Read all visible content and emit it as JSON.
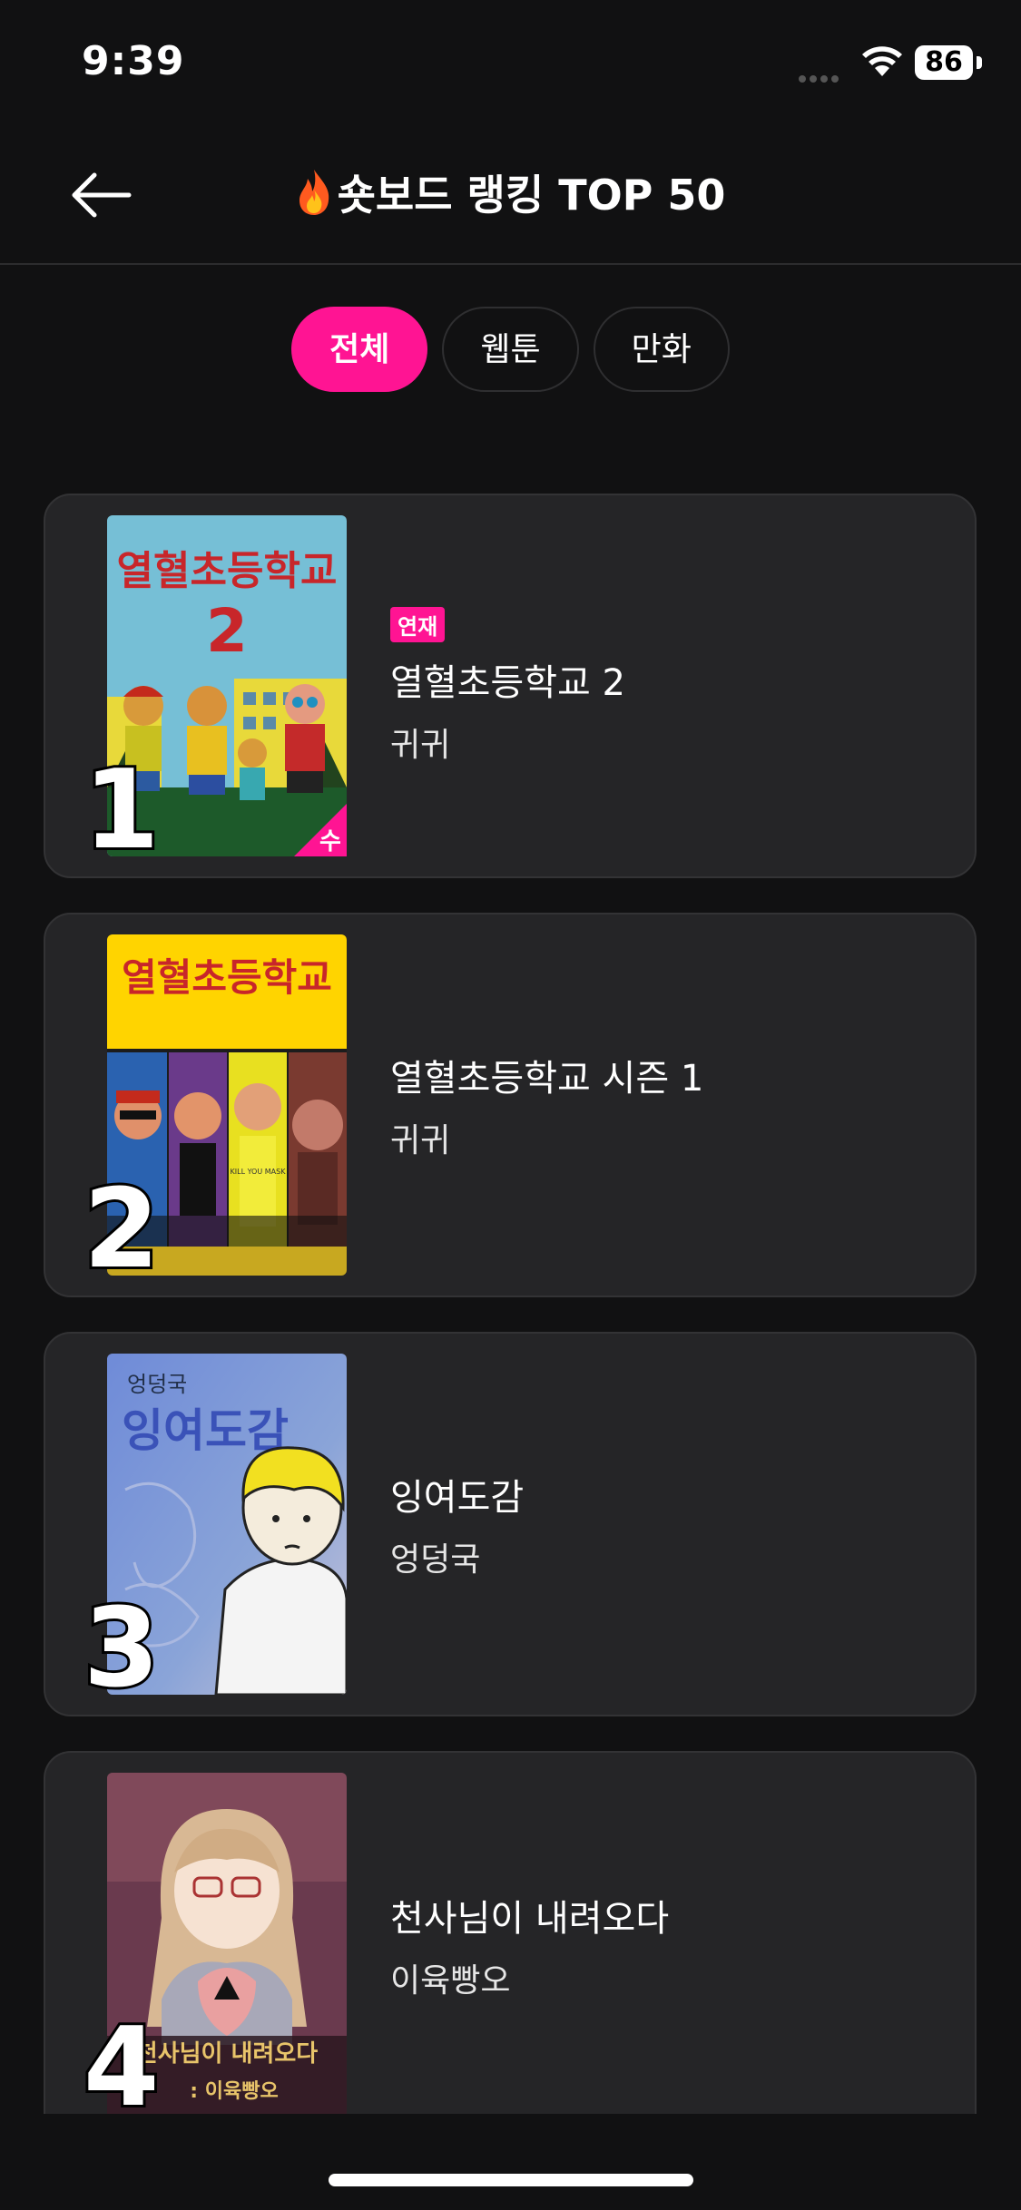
{
  "status_bar": {
    "time": "9:39",
    "battery": "86"
  },
  "header": {
    "title": "숏보드 랭킹 TOP 50",
    "back_icon": "back-arrow-icon",
    "title_icon": "fire-icon"
  },
  "tabs": [
    {
      "label": "전체",
      "active": true
    },
    {
      "label": "웹툰",
      "active": false
    },
    {
      "label": "만화",
      "active": false
    }
  ],
  "rankings": [
    {
      "rank": "1",
      "status_badge": "연재",
      "title": "열혈초등학교 2",
      "author": "귀귀",
      "age_badge": "수",
      "cover": {
        "title_text": "열혈초등학교",
        "number": "2"
      }
    },
    {
      "rank": "2",
      "title": "열혈초등학교 시즌 1",
      "author": "귀귀",
      "cover": {
        "title_text": "열혈초등학교",
        "shirt_text": "KILL YOU MASK"
      }
    },
    {
      "rank": "3",
      "title": "잉여도감",
      "author": "엉덩국",
      "cover": {
        "author_text": "엉덩국",
        "title_text": "잉여도감"
      }
    },
    {
      "rank": "4",
      "title": "천사님이 내려오다",
      "author": "이육빵오",
      "cover": {
        "title_text": "천사님이 내려오다",
        "author_text": ": 이육빵오"
      }
    }
  ],
  "colors": {
    "accent": "#ff1493",
    "background": "#111112",
    "card": "#252527"
  }
}
